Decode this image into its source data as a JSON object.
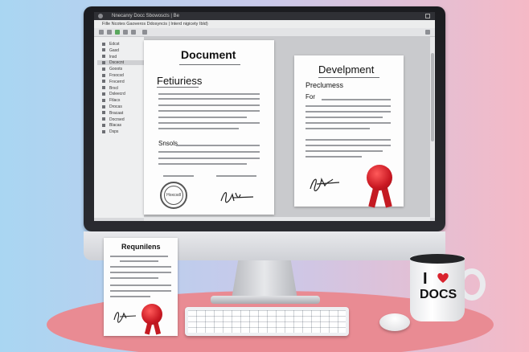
{
  "app": {
    "title_text": "Nnecanry Docc Sbowoscts | Be",
    "menu_text": "Fille  Ncotes  Gaoveros  Ddosyncis  |  lnterd nigicety  Ibld)",
    "sidebar_items": [
      "Edcst",
      "Gasd",
      "lnsd",
      "Dscecnt",
      "Gooots",
      "Frsocsd",
      "Frvcerrd",
      "Brscl",
      "Dsleecrd",
      "Ftlacs",
      "Drocas",
      "Bracaat",
      "Docrsed",
      "Blacas",
      "Dsps"
    ]
  },
  "documents": {
    "doc1": {
      "title": "Document",
      "heading": "Fetiuriess",
      "section": "Snsols",
      "stamp_text": "Hoxcsdl"
    },
    "doc2": {
      "title": "Develpment",
      "heading": "Preclumess",
      "section": "For"
    },
    "doc3": {
      "title": "Requnilens"
    }
  },
  "mug": {
    "line1": "I",
    "line2": "DOCS",
    "heart_color": "#d9232e"
  },
  "colors": {
    "seal": "#c91822",
    "desk": "#e98b93"
  }
}
